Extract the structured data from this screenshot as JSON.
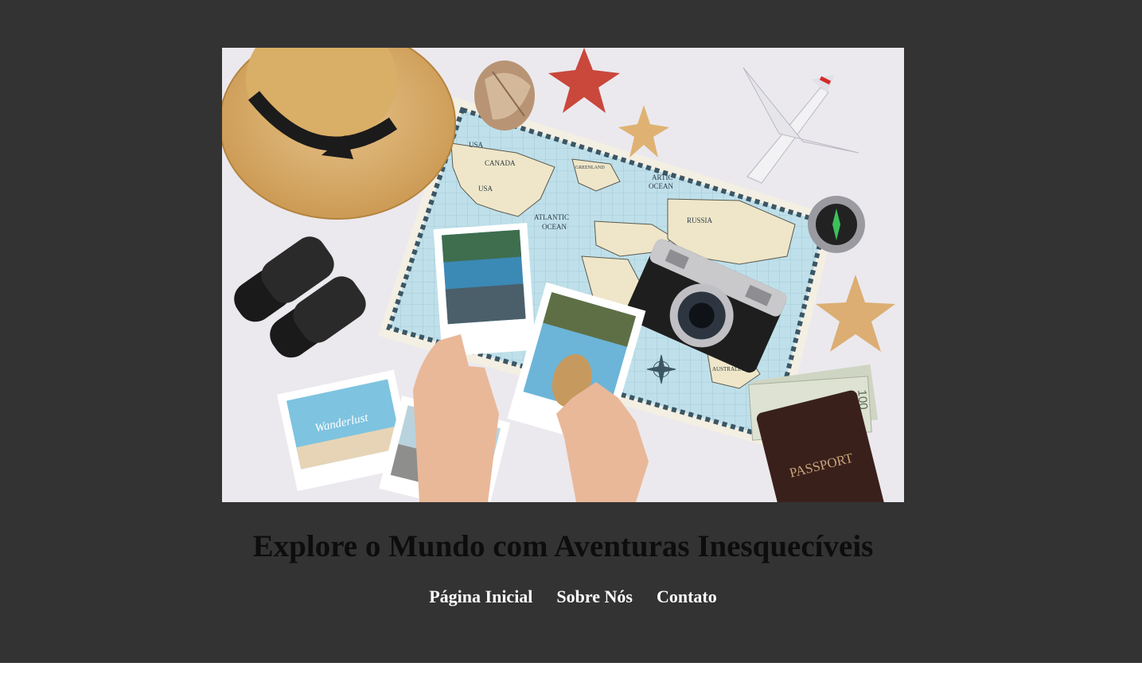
{
  "hero": {
    "map_labels": {
      "usa_small": "USA",
      "canada": "CANADA",
      "greenland": "GREENLAND",
      "usa": "USA",
      "arctic": "ARTIC",
      "ocean": "OCEAN",
      "atlantic": "ATLANTIC",
      "atlantic_ocean": "OCEAN",
      "russia": "RUSSIA",
      "australia": "AUSTRALIA"
    },
    "photo_caption": "Wanderlust",
    "passport_label": "PASSPORT",
    "money_value": "100"
  },
  "headline": "Explore o Mundo com Aventuras Inesquecíveis",
  "nav": {
    "home": "Página Inicial",
    "about": "Sobre Nós",
    "contact": "Contato"
  },
  "colors": {
    "page_background": "#333333",
    "headline": "#0d0d0d",
    "nav_links": "#ffffff"
  }
}
